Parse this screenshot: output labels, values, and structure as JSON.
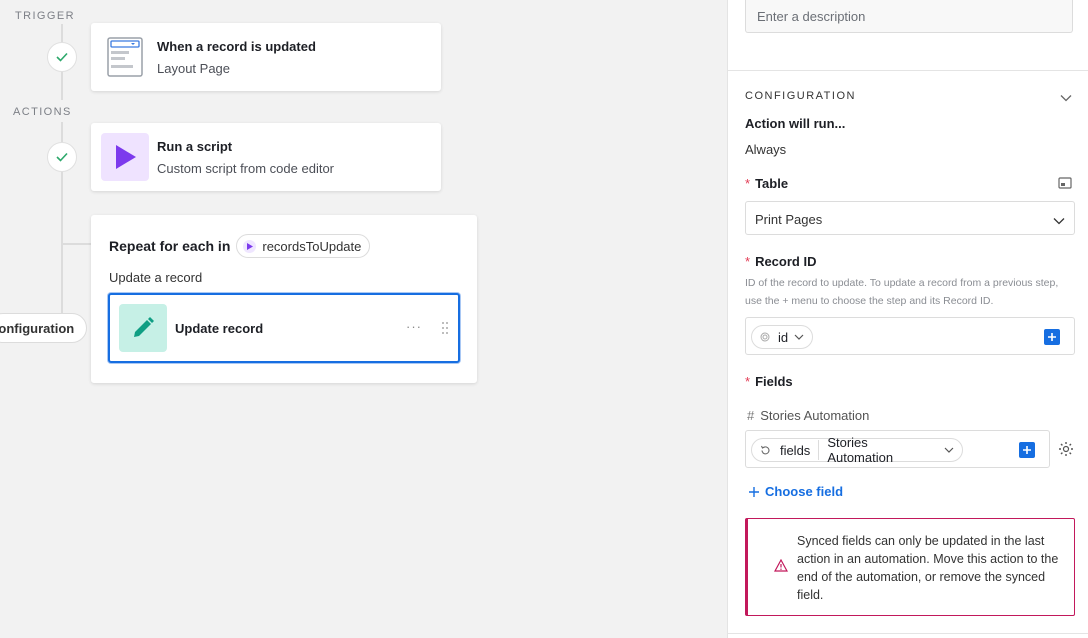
{
  "canvas": {
    "trigger_label": "TRIGGER",
    "actions_label": "ACTIONS",
    "trigger_card": {
      "title": "When a record is updated",
      "subtitle": "Layout Page",
      "icon": "layout-page-icon"
    },
    "script_card": {
      "title": "Run a script",
      "subtitle": "Custom script from code editor",
      "icon": "play-icon",
      "icon_bg": "#efe3ff",
      "icon_color": "#7c3aed"
    },
    "repeat": {
      "title": "Repeat for each in",
      "pill_label": "recordsToUpdate",
      "subtitle": "Update a record",
      "inner": {
        "title": "Update record",
        "icon": "pencil-icon",
        "icon_bg": "#c6f0e6",
        "icon_color": "#0f9e83",
        "more": "···"
      }
    },
    "config_pill": "Configuration"
  },
  "panel": {
    "description_placeholder": "Enter a description",
    "configuration_label": "CONFIGURATION",
    "action_will_run_label": "Action will run...",
    "action_will_run_value": "Always",
    "table_label": "Table",
    "table_value": "Print Pages",
    "record_id_label": "Record ID",
    "record_id_help": "ID of the record to update. To update a record from a previous step, use the + menu to choose the step and its Record ID.",
    "record_id_token": "id",
    "fields_label": "Fields",
    "field_name": "Stories Automation",
    "fields_token_left": "fields",
    "fields_token_right": "Stories Automation",
    "choose_field": "Choose field",
    "alert_text": "Synced fields can only be updated in the last action in an automation. Move this action to the end of the automation, or remove the synced field.",
    "accent": "#166ee1",
    "error": "#c2185b"
  }
}
